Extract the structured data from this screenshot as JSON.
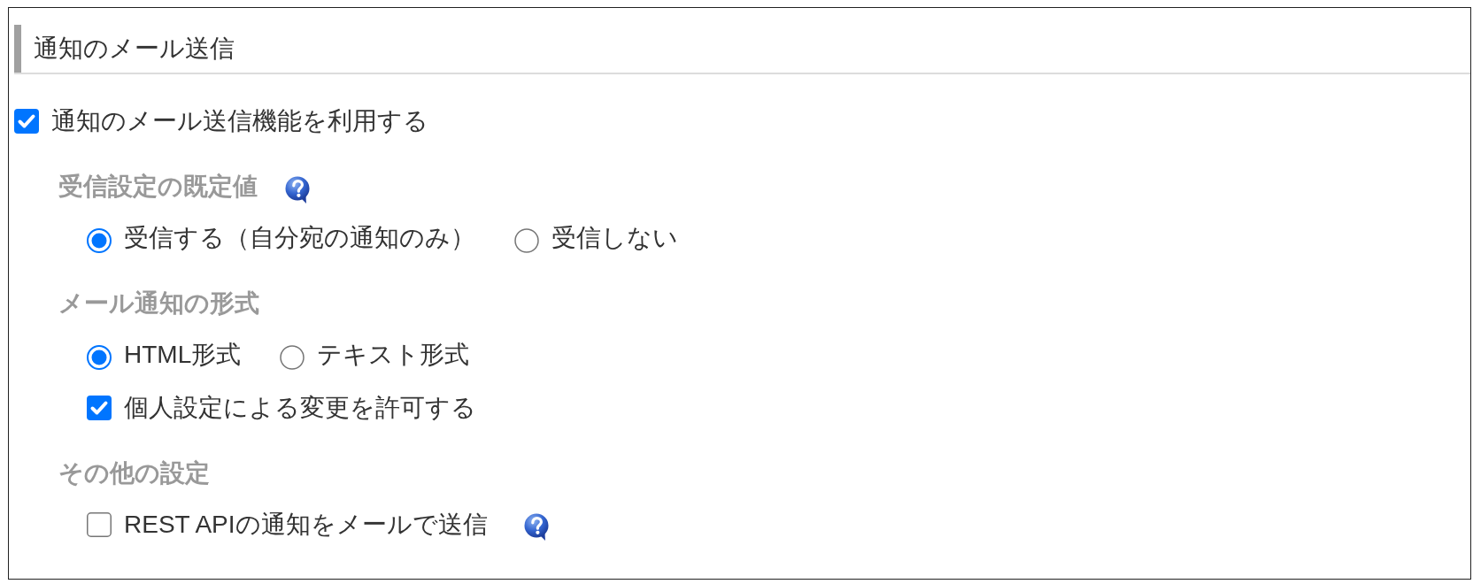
{
  "section": {
    "title": "通知のメール送信"
  },
  "enable": {
    "kind": "checkbox",
    "label": "通知のメール送信機能を利用する",
    "checked": true
  },
  "groups": [
    {
      "title": "受信設定の既定値",
      "help": true,
      "rows": [
        {
          "options": [
            {
              "kind": "radio",
              "label": "受信する（自分宛の通知のみ）",
              "selected": true
            },
            {
              "kind": "radio",
              "label": "受信しない",
              "selected": false
            }
          ]
        }
      ]
    },
    {
      "title": "メール通知の形式",
      "rows": [
        {
          "options": [
            {
              "kind": "radio",
              "label": "HTML形式",
              "selected": true
            },
            {
              "kind": "radio",
              "label": "テキスト形式",
              "selected": false
            }
          ]
        },
        {
          "options": [
            {
              "kind": "checkbox",
              "label": "個人設定による変更を許可する",
              "checked": true
            }
          ]
        }
      ]
    },
    {
      "title": "その他の設定",
      "rows": [
        {
          "options": [
            {
              "kind": "checkbox",
              "label": "REST APIの通知をメールで送信",
              "checked": false,
              "help": true
            }
          ]
        }
      ]
    }
  ]
}
